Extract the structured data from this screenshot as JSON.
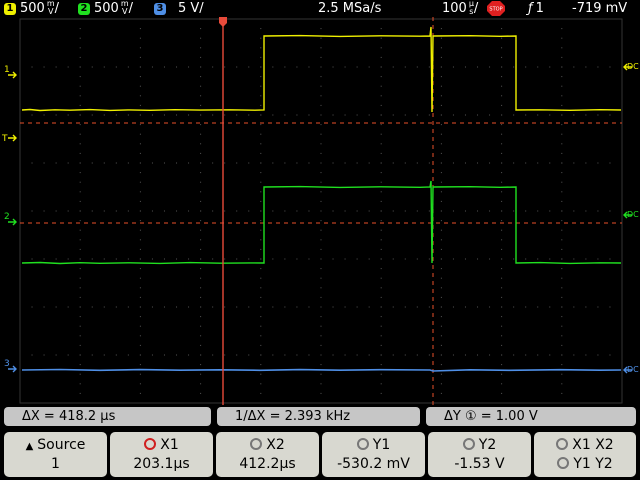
{
  "colors": {
    "ch1": "#f0f000",
    "ch2": "#20e020",
    "ch3": "#4f8fe6",
    "cursor_x1": "#e84a3a",
    "cursor_dashed": "#e8502a",
    "grid": "#555555",
    "background": "#000000",
    "softkey": "#d8d8d0"
  },
  "header": {
    "ch1": {
      "num": "1",
      "scale": "500",
      "unit_top": "m",
      "unit_bot": "V",
      "slash": "/"
    },
    "ch2": {
      "num": "2",
      "scale": "500",
      "unit_top": "m",
      "unit_bot": "V",
      "slash": "/"
    },
    "ch3": {
      "num": "3",
      "scale": "5 V/"
    },
    "sample_rate": "2.5 MSa/s",
    "timebase": {
      "value": "100",
      "unit_top": "µ",
      "unit_bot": "s",
      "slash": "/"
    },
    "run_state": "STOP",
    "trigger_channel": "1",
    "trigger_level": "-719 mV"
  },
  "markers": {
    "ch1": "1",
    "ch2": "2",
    "ch3": "3",
    "trig": "T",
    "coupling": "DC"
  },
  "measurements": {
    "delta_x": "ΔX = 418.2 µs",
    "inv_delta_x": "1/ΔX =  2.393 kHz",
    "delta_y": "ΔY ① =  1.00  V"
  },
  "softkeys": {
    "source": {
      "label": "Source",
      "value": "1"
    },
    "x1": {
      "label": "X1",
      "value": "203.1µs"
    },
    "x2": {
      "label": "X2",
      "value": "412.2µs"
    },
    "y1": {
      "label": "Y1",
      "value": "-530.2 mV"
    },
    "y2": {
      "label": "Y2",
      "value": "-1.53  V"
    },
    "pair": {
      "top": "X1  X2",
      "bottom": "Y1  Y2"
    }
  }
}
